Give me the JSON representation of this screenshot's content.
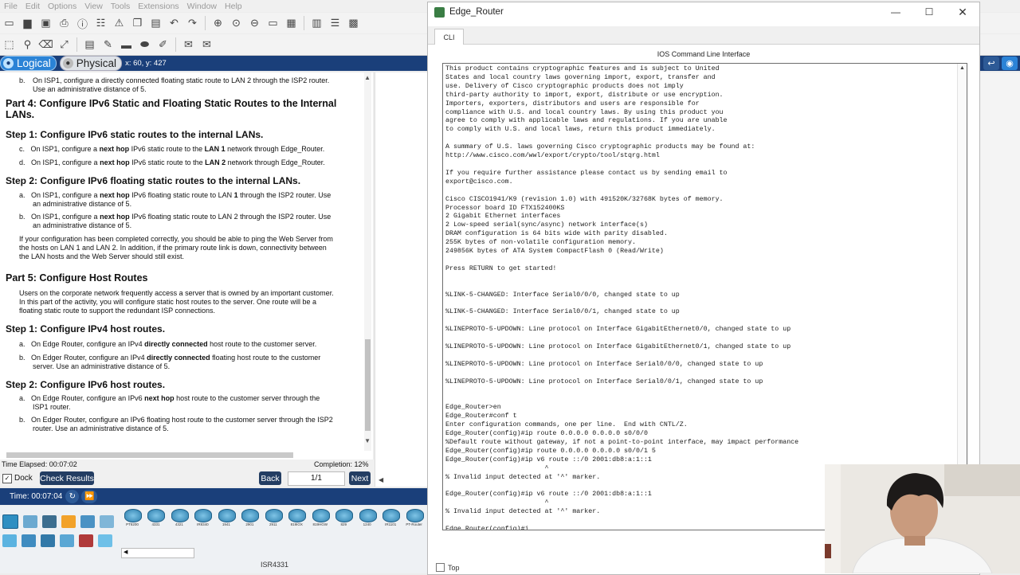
{
  "menu": [
    "File",
    "Edit",
    "Options",
    "View",
    "Tools",
    "Extensions",
    "Window",
    "Help"
  ],
  "modes": {
    "logical": "Logical",
    "physical": "Physical",
    "coords": "x: 60, y: 427"
  },
  "instructions": {
    "item_b_isp1": "On ISP1, configure a directly connected floating static route to LAN 2 through the ISP2 router. Use an administrative distance of 5.",
    "part4_title": "Part 4: Configure IPv6 Static and Floating Static Routes to the Internal",
    "part4_title2": "LANs.",
    "step1_title": "Step 1: Configure IPv6 static routes to the internal LANs.",
    "step1_c": [
      "On ISP1, configure a ",
      "next hop",
      " IPv6 static route to the ",
      "LAN 1",
      " network through Edge_Router."
    ],
    "step1_d": [
      "On ISP1, configure a ",
      "next hop",
      " IPv6 static route to the ",
      "LAN 2",
      " network through Edge_Router."
    ],
    "step2_title": "Step 2: Configure IPv6 floating static routes to the internal LANs.",
    "step2_a": [
      "On ISP1, configure a ",
      "next hop",
      " IPv6 floating static route to LAN ",
      "1",
      " through the ISP2 router. Use",
      "an administrative distance of 5."
    ],
    "step2_b": [
      "On ISP1, configure a ",
      "next hop",
      " IPv6 floating static route to LAN 2 through the ISP2 router. Use",
      "an administrative distance of 5."
    ],
    "para_config": [
      "If your configuration has been completed correctly, you should be able to ping the Web Server from",
      "the hosts on LAN 1 and LAN 2. In addition, if the primary route link is down, connectivity between",
      "the LAN hosts and the Web Server should still exist."
    ],
    "part5_title": "Part 5: Configure Host Routes",
    "para_users": [
      "Users on the corporate network frequently access a server that is owned by an important customer.",
      "In this part of the activity, you will configure static host routes to the server. One route will be a",
      "floating static route to support the redundant ISP connections."
    ],
    "step1b_title": "Step 1: Configure IPv4 host routes.",
    "h4_a": [
      "On Edge Router, configure an IPv4 ",
      "directly connected",
      " host route to the customer server."
    ],
    "h4_b": [
      "On Edger Router, configure an IPv4 ",
      "directly connected",
      " floating host route to the customer",
      "server. Use an administrative distance of 5."
    ],
    "step2b_title": "Step 2: Configure IPv6 host routes.",
    "h6_a": [
      "On Edge Router, configure an IPv6 ",
      "next hop",
      " host route to the customer server through the",
      "ISP1 router."
    ],
    "h6_b": [
      "On Edger Router, configure an IPv6 floating host route to the customer server through the ISP2",
      "router. Use an administrative distance of 5."
    ]
  },
  "status": {
    "elapsed": "Time Elapsed: 00:07:02",
    "completion": "Completion: 12%"
  },
  "controls": {
    "dock": "Dock",
    "check": "Check Results",
    "back": "Back",
    "page": "1/1",
    "next": "Next"
  },
  "timebar": {
    "time": "Time: 00:07:04"
  },
  "devices": [
    "PT8200",
    "4331",
    "4321",
    "IR8340",
    "1941",
    "2901",
    "2911",
    "819IOX",
    "819HGW",
    "829",
    "1240",
    "IR1101",
    "PT-Router"
  ],
  "device_selected": "ISR4331",
  "window": {
    "title": "Edge_Router",
    "tab": "CLI",
    "cli_label": "IOS Command Line Interface",
    "top_checkbox": "Top"
  },
  "terminal_lines": [
    "This product contains cryptographic features and is subject to United",
    "States and local country laws governing import, export, transfer and",
    "use. Delivery of Cisco cryptographic products does not imply",
    "third-party authority to import, export, distribute or use encryption.",
    "Importers, exporters, distributors and users are responsible for",
    "compliance with U.S. and local country laws. By using this product you",
    "agree to comply with applicable laws and regulations. If you are unable",
    "to comply with U.S. and local laws, return this product immediately.",
    "",
    "A summary of U.S. laws governing Cisco cryptographic products may be found at:",
    "http://www.cisco.com/wwl/export/crypto/tool/stqrg.html",
    "",
    "If you require further assistance please contact us by sending email to",
    "export@cisco.com.",
    "",
    "Cisco CISCO1941/K9 (revision 1.0) with 491520K/32768K bytes of memory.",
    "Processor board ID FTX152400KS",
    "2 Gigabit Ethernet interfaces",
    "2 Low-speed serial(sync/async) network interface(s)",
    "DRAM configuration is 64 bits wide with parity disabled.",
    "255K bytes of non-volatile configuration memory.",
    "249856K bytes of ATA System CompactFlash 0 (Read/Write)",
    "",
    "Press RETURN to get started!",
    "",
    "",
    "%LINK-5-CHANGED: Interface Serial0/0/0, changed state to up",
    "",
    "%LINK-5-CHANGED: Interface Serial0/0/1, changed state to up",
    "",
    "%LINEPROTO-5-UPDOWN: Line protocol on Interface GigabitEthernet0/0, changed state to up",
    "",
    "%LINEPROTO-5-UPDOWN: Line protocol on Interface GigabitEthernet0/1, changed state to up",
    "",
    "%LINEPROTO-5-UPDOWN: Line protocol on Interface Serial0/0/0, changed state to up",
    "",
    "%LINEPROTO-5-UPDOWN: Line protocol on Interface Serial0/0/1, changed state to up",
    "",
    "",
    "Edge_Router>en",
    "Edge_Router#conf t",
    "Enter configuration commands, one per line.  End with CNTL/Z.",
    "Edge_Router(config)#ip route 0.0.0.0 0.0.0.0 s0/0/0",
    "%Default route without gateway, if not a point-to-point interface, may impact performance",
    "Edge_Router(config)#ip route 0.0.0.0 0.0.0.0 s0/0/1 5",
    "Edge_Router(config)#ip v6 route ::/0 2001:db8:a:1::1",
    "                         ^",
    "% Invalid input detected at '^' marker.",
    "",
    "Edge_Router(config)#ip v6 route ::/0 2001:db8:a:1::1",
    "                         ^",
    "% Invalid input detected at '^' marker.",
    "",
    "Edge_Router(config)#i"
  ]
}
